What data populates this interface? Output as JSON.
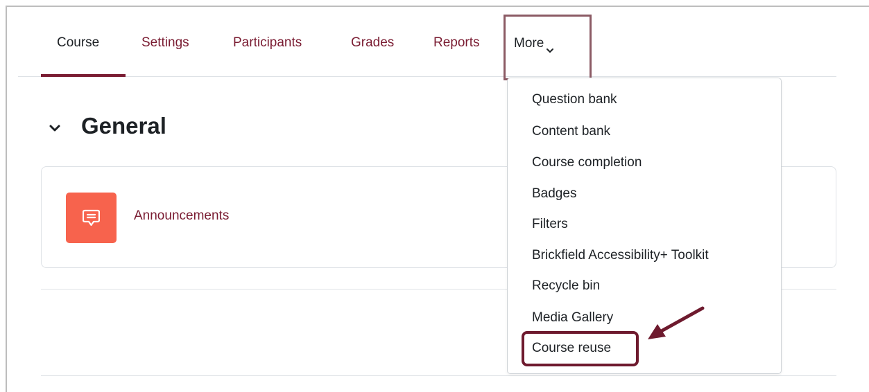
{
  "nav": {
    "tabs": [
      {
        "label": "Course",
        "active": true
      },
      {
        "label": "Settings"
      },
      {
        "label": "Participants"
      },
      {
        "label": "Grades"
      },
      {
        "label": "Reports"
      }
    ],
    "more_label": "More"
  },
  "section": {
    "title": "General",
    "icon": "chevron-down-icon"
  },
  "activity": {
    "name": "Announcements",
    "icon": "forum-icon",
    "icon_color": "#f7634d"
  },
  "more_menu": {
    "items": [
      "Question bank",
      "Content bank",
      "Course completion",
      "Badges",
      "Filters",
      "Brickfield Accessibility+ Toolkit",
      "Recycle bin",
      "Media Gallery",
      "Course reuse"
    ],
    "highlighted_item": "Course reuse"
  },
  "colors": {
    "brand": "#7a1c32",
    "highlight_border": "#6e1a2e",
    "text": "#1d2125"
  }
}
